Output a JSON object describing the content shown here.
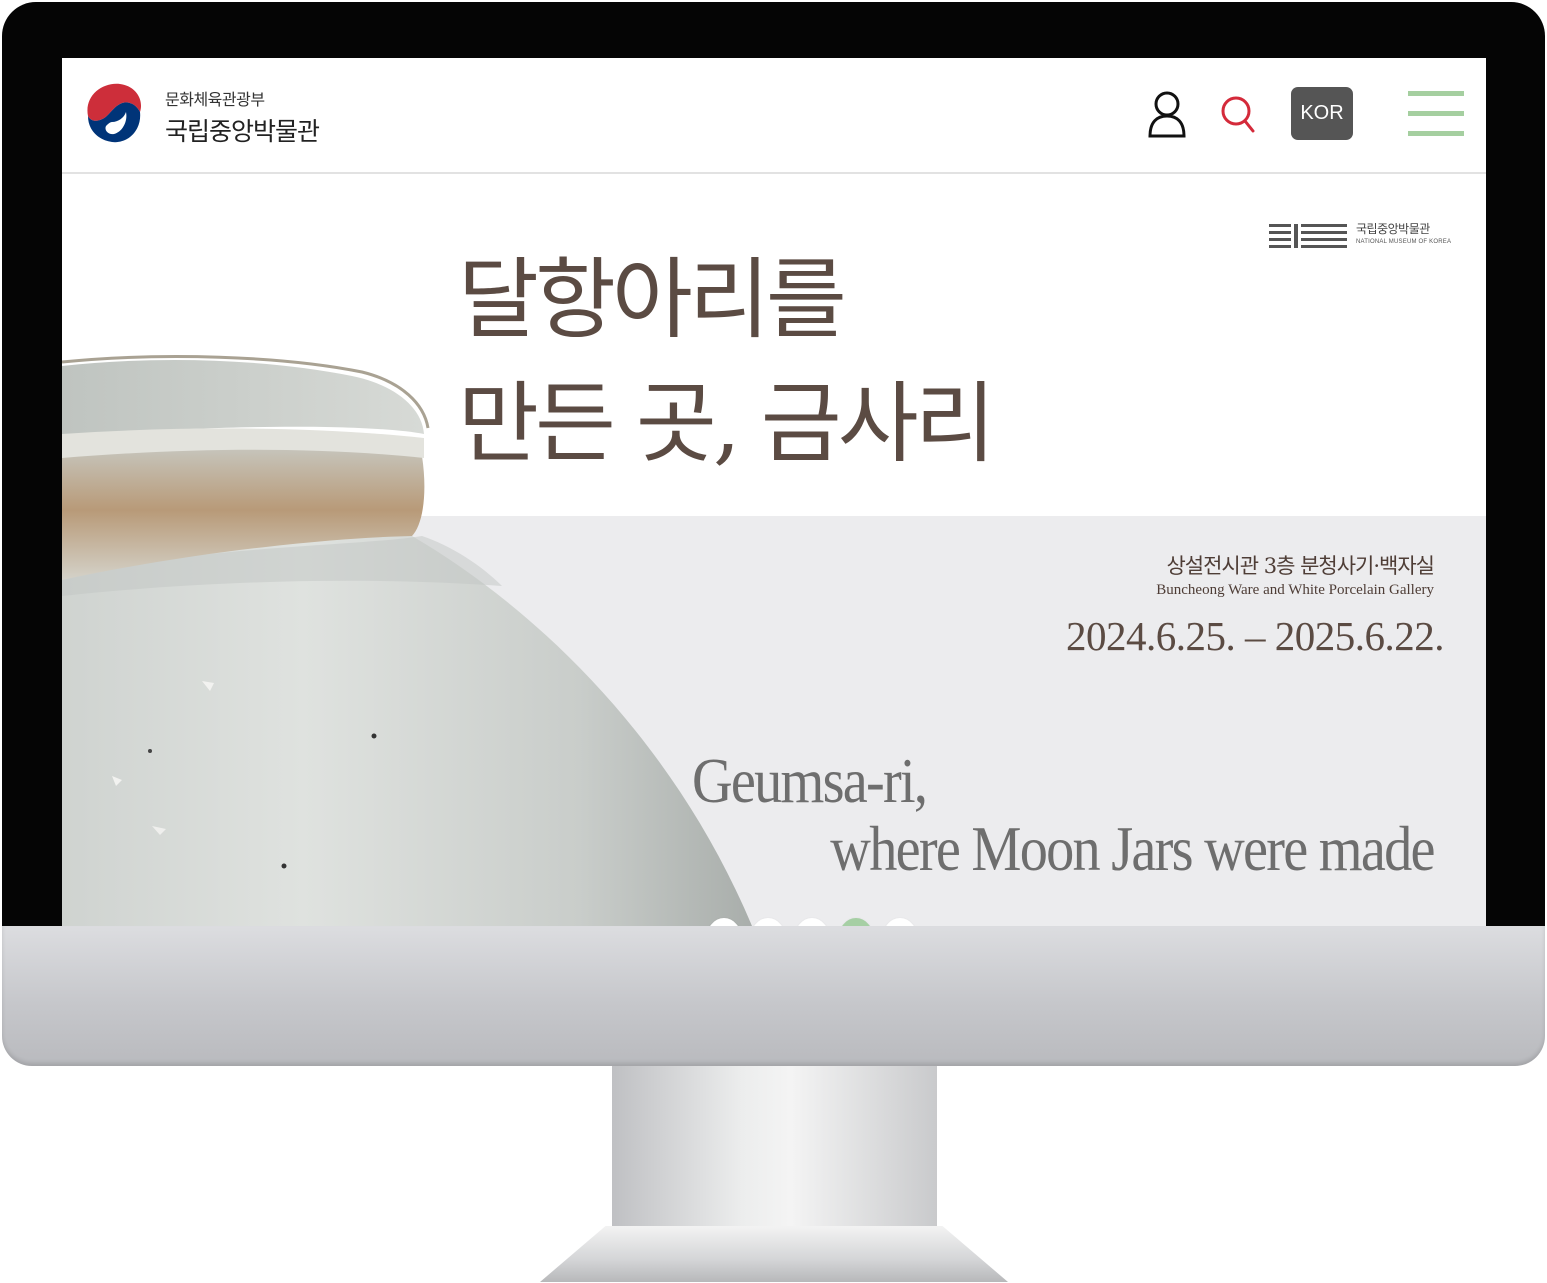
{
  "header": {
    "logo_sub": "문화체육관광부",
    "logo_main": "국립중앙박물관",
    "lang_label": "KOR",
    "icons": [
      "user-icon",
      "search-icon",
      "menu-icon"
    ],
    "accent_green": "#a5cfa0",
    "search_red": "#d42a3a"
  },
  "hero": {
    "title_lines": [
      "달항아리를",
      "만든 곳, 금사리"
    ],
    "museum_mark_ko": "국립중앙박물관",
    "museum_mark_en": "NATIONAL MUSEUM OF KOREA",
    "gallery_ko": "상설전시관 3층 분청사기·백자실",
    "gallery_en": "Buncheong Ware and White Porcelain Gallery",
    "date_range": "2024.6.25. – 2025.6.22.",
    "en_title_line1": "Geumsa-ri,",
    "en_title_line2": "where Moon Jars were made"
  },
  "slider": {
    "total_slides": 5,
    "active_slide": 4
  }
}
